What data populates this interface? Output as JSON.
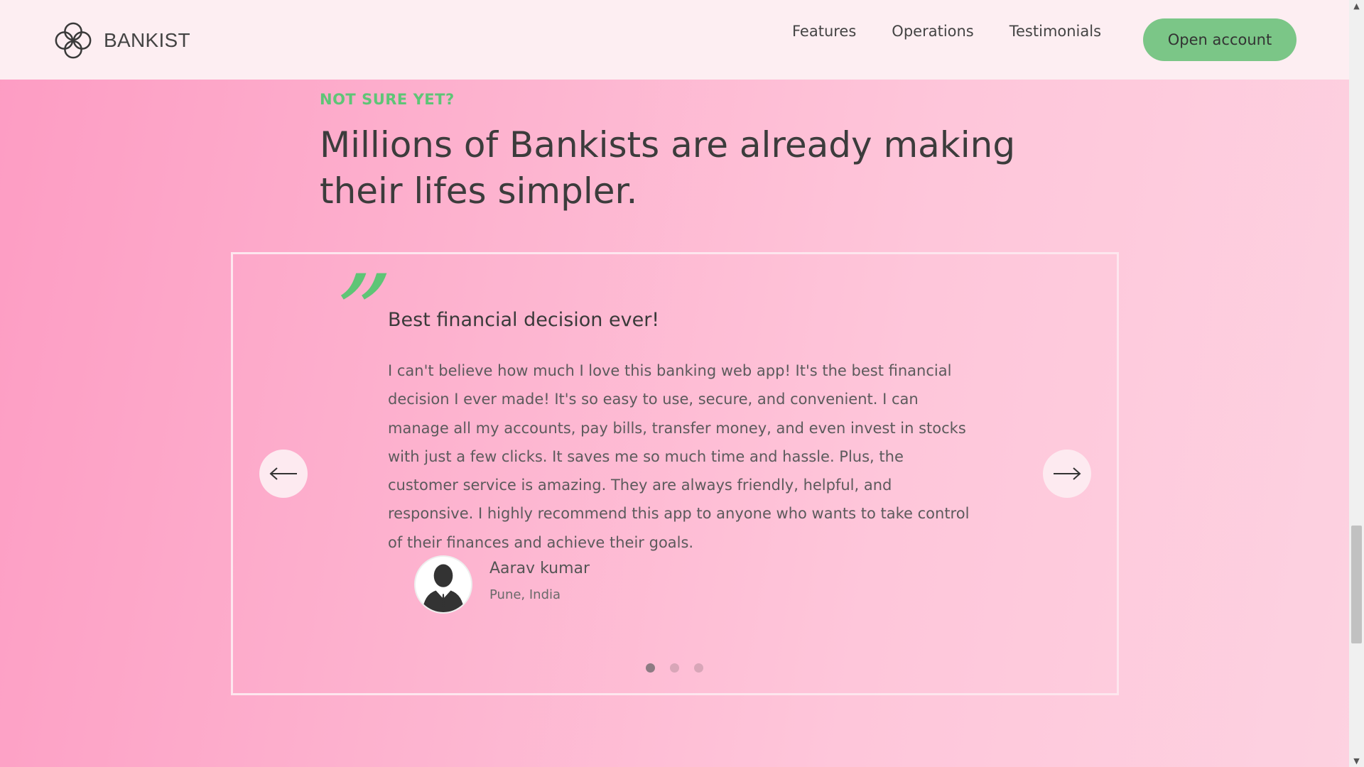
{
  "nav": {
    "brand": "BANKIST",
    "links": [
      "Features",
      "Operations",
      "Testimonials"
    ],
    "cta": "Open account"
  },
  "section": {
    "eyebrow": "NOT SURE YET?",
    "headline": "Millions of Bankists are already making their lifes simpler."
  },
  "slide": {
    "title": "Best financial decision ever!",
    "text": "I can't believe how much I love this banking web app! It's the best financial decision I ever made! It's so easy to use, secure, and convenient. I can manage all my accounts, pay bills, transfer money, and even invest in stocks with just a few clicks. It saves me so much time and hassle. Plus, the customer service is amazing. They are always friendly, helpful, and responsive. I highly recommend this app to anyone who wants to take control of their finances and achieve their goals.",
    "author_name": "Aarav kumar",
    "author_location": "Pune, India"
  },
  "slider": {
    "dot_count": 3,
    "active_dot": 0,
    "prev_icon": "arrow-left-icon",
    "next_icon": "arrow-right-icon"
  },
  "colors": {
    "accent_green": "#5ec576",
    "button_green": "#7bc687",
    "nav_bg": "#fdeef2"
  }
}
